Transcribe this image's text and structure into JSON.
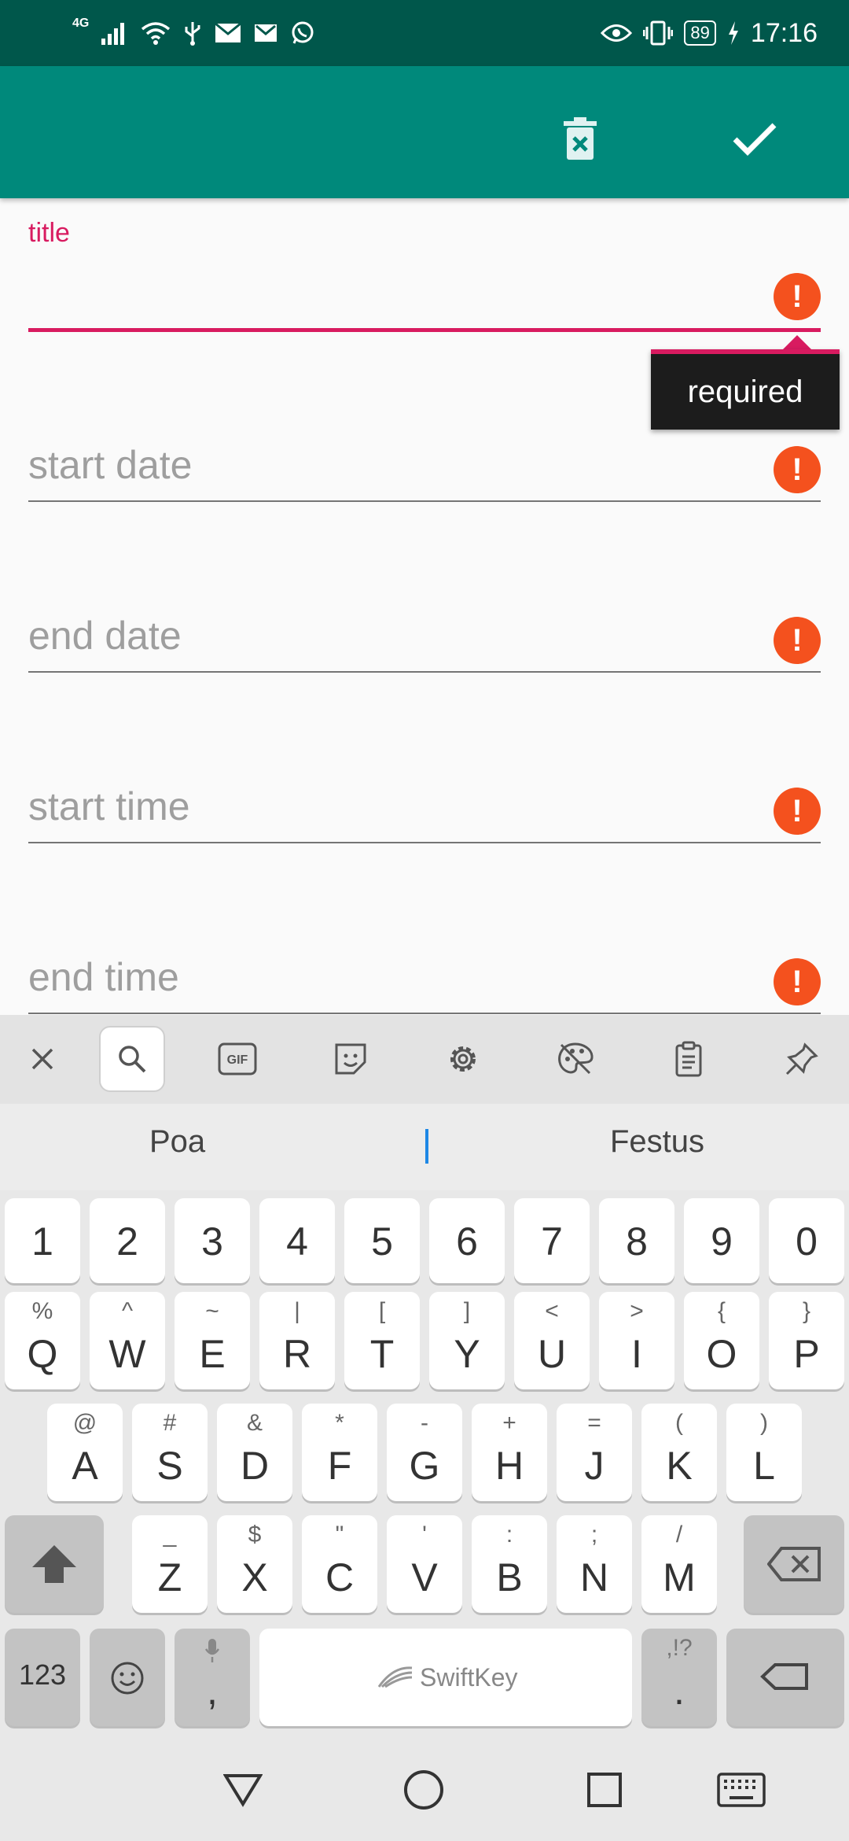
{
  "status_bar": {
    "network": "4G",
    "battery": "89",
    "time": "17:16"
  },
  "app_bar": {
    "delete_icon": "delete-forever-icon",
    "save_icon": "check-icon"
  },
  "form": {
    "title": {
      "label": "title",
      "value": "",
      "error_tooltip": "required"
    },
    "start_date": {
      "placeholder": "start date"
    },
    "end_date": {
      "placeholder": "end date"
    },
    "start_time": {
      "placeholder": "start time"
    },
    "end_time": {
      "placeholder": "end time"
    },
    "error_glyph": "!"
  },
  "keyboard": {
    "toolbar_icons": [
      "close-icon",
      "search-icon",
      "gif-icon",
      "sticker-icon",
      "gear-icon",
      "theme-palette-icon",
      "clipboard-icon",
      "pin-icon"
    ],
    "suggestions": [
      "Poa",
      "",
      "Festus"
    ],
    "number_row": [
      "1",
      "2",
      "3",
      "4",
      "5",
      "6",
      "7",
      "8",
      "9",
      "0"
    ],
    "row1": [
      {
        "main": "Q",
        "sub": "%"
      },
      {
        "main": "W",
        "sub": "^"
      },
      {
        "main": "E",
        "sub": "~"
      },
      {
        "main": "R",
        "sub": "|"
      },
      {
        "main": "T",
        "sub": "["
      },
      {
        "main": "Y",
        "sub": "]"
      },
      {
        "main": "U",
        "sub": "<"
      },
      {
        "main": "I",
        "sub": ">"
      },
      {
        "main": "O",
        "sub": "{"
      },
      {
        "main": "P",
        "sub": "}"
      }
    ],
    "row2": [
      {
        "main": "A",
        "sub": "@"
      },
      {
        "main": "S",
        "sub": "#"
      },
      {
        "main": "D",
        "sub": "&"
      },
      {
        "main": "F",
        "sub": "*"
      },
      {
        "main": "G",
        "sub": "-"
      },
      {
        "main": "H",
        "sub": "+"
      },
      {
        "main": "J",
        "sub": "="
      },
      {
        "main": "K",
        "sub": "("
      },
      {
        "main": "L",
        "sub": ")"
      }
    ],
    "row3": [
      {
        "main": "Z",
        "sub": "_"
      },
      {
        "main": "X",
        "sub": "$"
      },
      {
        "main": "C",
        "sub": "\""
      },
      {
        "main": "V",
        "sub": "'"
      },
      {
        "main": "B",
        "sub": ":"
      },
      {
        "main": "N",
        "sub": ";"
      },
      {
        "main": "M",
        "sub": "/"
      }
    ],
    "bottom": {
      "numbers_label": "123",
      "comma_label": ",",
      "space_label": "SwiftKey",
      "period_label": ".",
      "period_sub": ",!?"
    }
  },
  "nav_bar": {
    "icons": [
      "back-icon",
      "home-icon",
      "recents-icon",
      "keyboard-icon"
    ]
  }
}
